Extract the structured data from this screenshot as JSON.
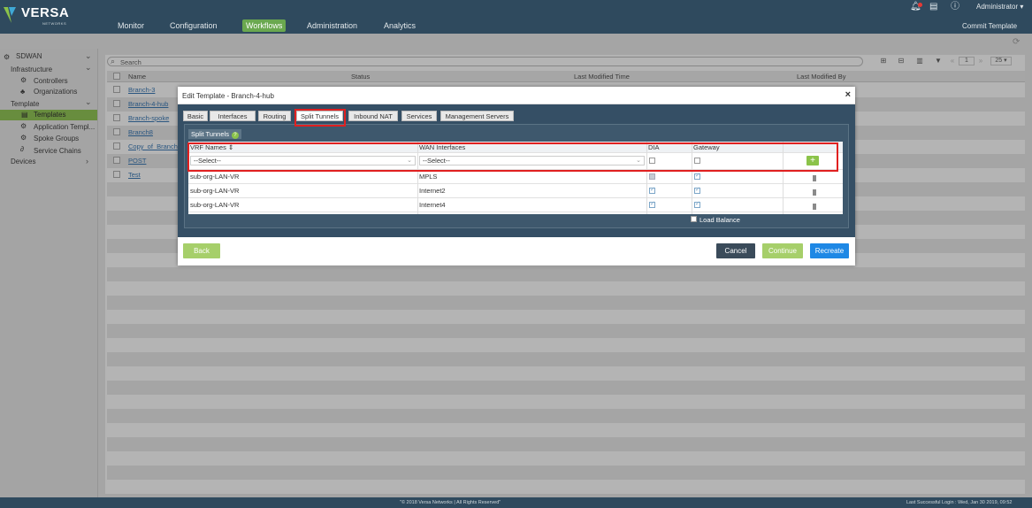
{
  "brand": {
    "name": "VERSA",
    "sub": "NETWORKS"
  },
  "nav": [
    "Monitor",
    "Configuration",
    "Workflows",
    "Administration",
    "Analytics"
  ],
  "nav_active": "Workflows",
  "user": "Administrator",
  "commit": "Commit Template",
  "sidebar": {
    "root": "SDWAN",
    "infrastructure": "Infrastructure",
    "controllers": "Controllers",
    "organizations": "Organizations",
    "template": "Template",
    "templates": "Templates",
    "application_templates": "Application Templ...",
    "spoke_groups": "Spoke Groups",
    "service_chains": "Service Chains",
    "devices": "Devices"
  },
  "search_placeholder": "Search",
  "pager": {
    "page": "1",
    "size": "25"
  },
  "table": {
    "headers": [
      "Name",
      "Status",
      "Last Modified Time",
      "Last Modified By"
    ],
    "rows": [
      "Branch-3",
      "Branch-4-hub",
      "Branch-spoke",
      "Branch8",
      "Copy_of_Branch...",
      "POST",
      "Test"
    ]
  },
  "modal": {
    "title": "Edit Template - Branch-4-hub",
    "tabs": [
      "Basic",
      "Interfaces",
      "Routing",
      "Split Tunnels",
      "Inbound NAT",
      "Services",
      "Management Servers"
    ],
    "active_tab": "Split Tunnels",
    "panel_title": "Split Tunnels",
    "grid_headers": [
      "VRF Names",
      "WAN Interfaces",
      "DIA",
      "Gateway"
    ],
    "select_placeholder": "--Select--",
    "rows": [
      {
        "vrf": "sub-org-LAN-VR",
        "wan": "MPLS"
      },
      {
        "vrf": "sub-org-LAN-VR",
        "wan": "Internet2"
      },
      {
        "vrf": "sub-org-LAN-VR",
        "wan": "Internet4"
      }
    ],
    "load_balance": "Load Balance",
    "buttons": {
      "back": "Back",
      "cancel": "Cancel",
      "continue": "Continue",
      "recreate": "Recreate"
    }
  },
  "footer": {
    "copyright": "\"© 2018 Versa Networks | All Rights Reserved\"",
    "login": "Last Successful Login : Wed, Jan 30 2019, 09:52"
  },
  "colors": {
    "header": "#2f4a5e",
    "accent_green": "#8bc34a",
    "recreate_blue": "#1e88e5",
    "cancel_dark": "#3a4b5a",
    "highlight_red": "#e02020"
  }
}
